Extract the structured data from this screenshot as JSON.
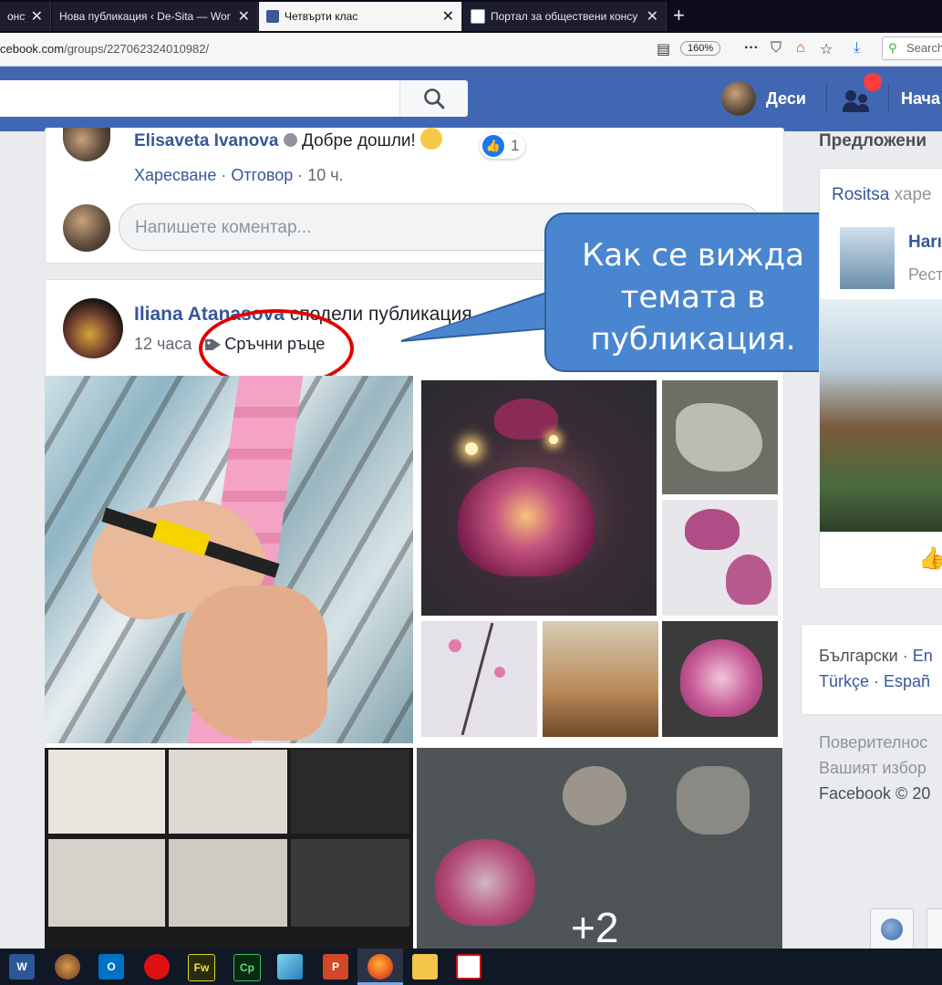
{
  "tabs": [
    {
      "label": "онсу",
      "close": "✕"
    },
    {
      "label": "Нова публикация ‹ De-Sita — Wor",
      "close": "✕"
    },
    {
      "label": "Четвърти клас",
      "close": "✕"
    },
    {
      "label": "Портал за обществени консу",
      "close": "✕"
    }
  ],
  "new_tab": "+",
  "address": {
    "prefix": "cebook.com",
    "path": "/groups/227062324010982/",
    "zoom": "160%",
    "search_placeholder": "Search"
  },
  "header": {
    "user": "Деси",
    "home": "Нача"
  },
  "comment": {
    "author": "Elisaveta Ivanova",
    "text": "Добре дошли!",
    "reactions": "1",
    "like": "Харесване",
    "reply": "Отговор",
    "time": "10 ч.",
    "sep": "·",
    "input_placeholder": "Напишете коментар..."
  },
  "post": {
    "author": "Iliana Atanasova",
    "action": "сподели публикация.",
    "time": "12 часа",
    "topic": "Сръчни ръце",
    "more_photos": "+2"
  },
  "callout": {
    "line1": "Как се вижда",
    "line2": "темата в",
    "line3": "публикация."
  },
  "sidebar": {
    "title": "Предложени",
    "liked_by": "Rositsa",
    "liked_text": "харе",
    "page_name": "Harı",
    "page_type": "Рест",
    "languages": [
      "Български",
      "En",
      "Türkçe",
      "Españ"
    ],
    "footer": [
      "Поверителнос",
      "Вашият избор",
      "Facebook © 20"
    ]
  },
  "taskbar": [
    "W",
    "O",
    "Fw",
    "Cp",
    "P"
  ]
}
